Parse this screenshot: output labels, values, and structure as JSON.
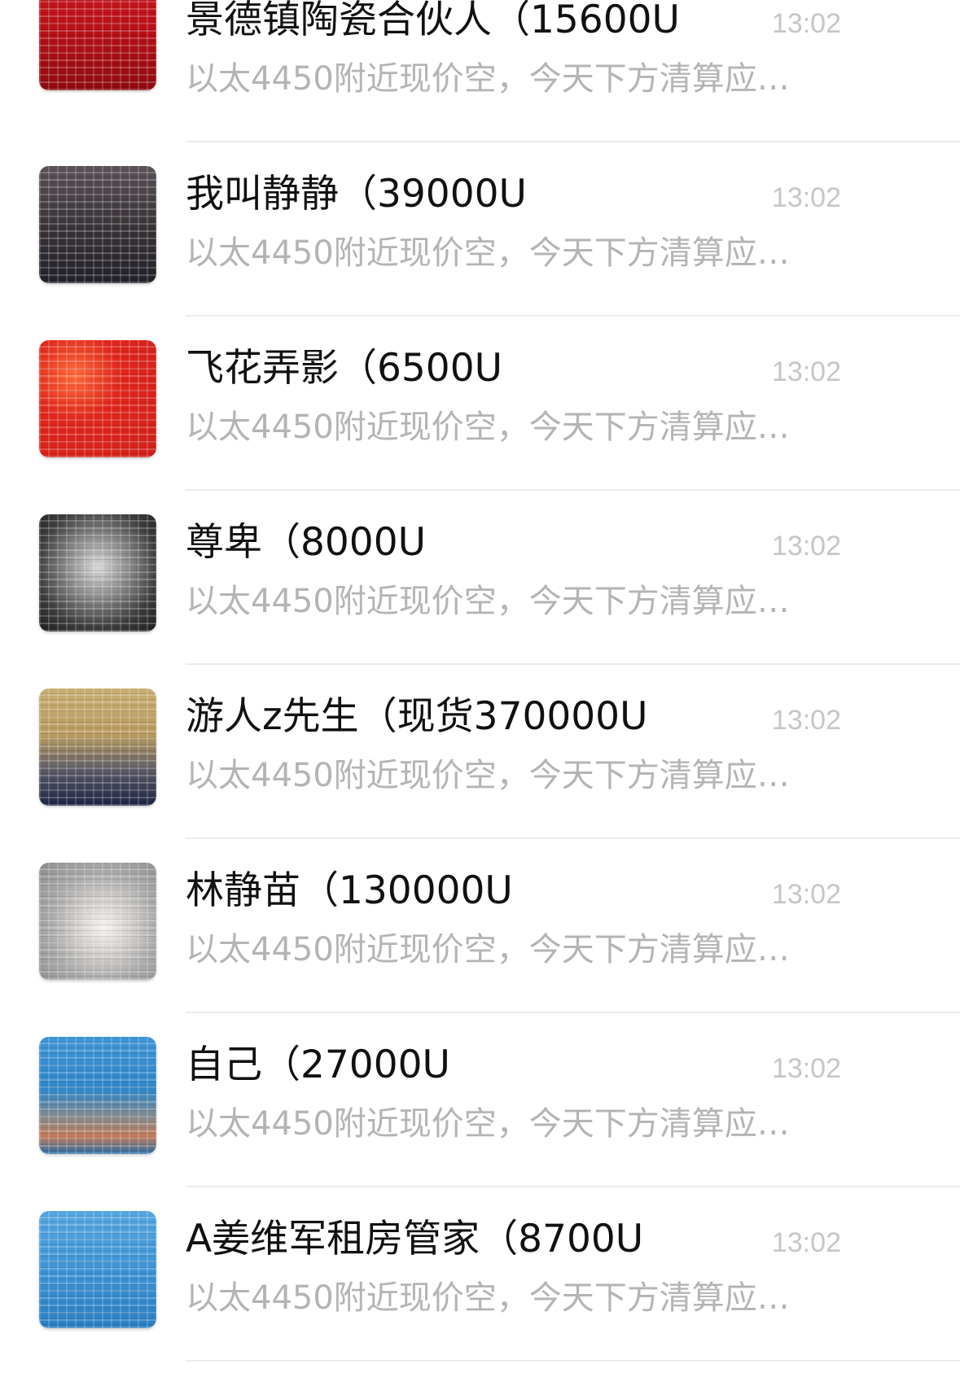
{
  "chats": [
    {
      "name": "景德镇陶瓷合伙人（15600U",
      "time": "13:02",
      "preview": "以太4450附近现价空，今天下方清算应…",
      "avatar_color": "#c8141c",
      "avatar_icon": "logo-avatar"
    },
    {
      "name": "我叫静静（39000U",
      "time": "13:02",
      "preview": "以太4450附近现价空，今天下方清算应…",
      "avatar_color": "#4a4448",
      "avatar_icon": "user-avatar"
    },
    {
      "name": "飞花弄影（6500U",
      "time": "13:02",
      "preview": "以太4450附近现价空，今天下方清算应…",
      "avatar_color": "#e1251b",
      "avatar_icon": "flag-avatar"
    },
    {
      "name": "尊卑（8000U",
      "time": "13:02",
      "preview": "以太4450附近现价空，今天下方清算应…",
      "avatar_color": "#6a6a6a",
      "avatar_icon": "user-avatar"
    },
    {
      "name": "游人z先生（现货370000U",
      "time": "13:02",
      "preview": "以太4450附近现价空，今天下方清算应…",
      "avatar_color": "#a8905a",
      "avatar_icon": "user-avatar"
    },
    {
      "name": "林静苗（130000U",
      "time": "13:02",
      "preview": "以太4450附近现价空，今天下方清算应…",
      "avatar_color": "#b9b9b9",
      "avatar_icon": "user-avatar"
    },
    {
      "name": "自己（27000U",
      "time": "13:02",
      "preview": "以太4450附近现价空，今天下方清算应…",
      "avatar_color": "#2f86c8",
      "avatar_icon": "user-avatar"
    },
    {
      "name": "A姜维军租房管家（8700U",
      "time": "13:02",
      "preview": "以太4450附近现价空，今天下方清算应…",
      "avatar_color": "#3d93d4",
      "avatar_icon": "user-avatar"
    }
  ]
}
